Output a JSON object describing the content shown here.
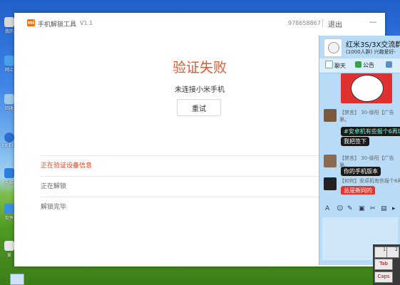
{
  "desktop": {
    "icons": [
      {
        "label": "我的",
        "icon": "computer-icon"
      },
      {
        "label": "网上",
        "icon": "network-icon"
      },
      {
        "label": "回收",
        "icon": "recycle-bin-icon"
      },
      {
        "label": "Int Exp",
        "icon": "internet-explorer-icon"
      },
      {
        "label": "电脑",
        "icon": "security-shield-icon"
      },
      {
        "label": "软件",
        "icon": "software-icon"
      },
      {
        "label": "爱",
        "icon": "app-icon"
      }
    ]
  },
  "unlock_app": {
    "title": "手机解锁工具",
    "version": "V1.1",
    "account_id": "978658867",
    "logout_label": "退出",
    "minimize_label": "—",
    "status_title": "验证失败",
    "status_subtitle": "未连接小米手机",
    "retry_label": "重试",
    "steps": [
      {
        "label": "正在验证设备信息",
        "state": "active"
      },
      {
        "label": "正在解锁",
        "state": "pending"
      },
      {
        "label": "解锁完毕",
        "state": "pending"
      }
    ],
    "accent_color": "#ff6700",
    "error_color": "#e4572e"
  },
  "qq_group": {
    "name": "红米3S/3X交流群",
    "sub": "(1000人群) 兴趣爱好-",
    "tabs": [
      {
        "label": "聊天",
        "icon": "chat-icon"
      },
      {
        "label": "公告",
        "icon": "announcement-icon"
      },
      {
        "label": "",
        "icon": "photo-icon"
      }
    ],
    "messages": [
      {
        "meta": "【禁言】 30-级阳【广告",
        "cont": "第。",
        "bubble": "#安卓机有些报个6再填",
        "bubble2": "我把签下"
      },
      {
        "meta": "【禁言】 30-级阳【广告",
        "cont": "第。",
        "bubble": "你的手机版本"
      },
      {
        "meta": "【如何】安卓机有些报个6再",
        "bubble": "总是新同的"
      }
    ],
    "toolbar_icons": [
      "font-icon",
      "emoji-icon",
      "shake-icon",
      "gift-icon",
      "screenshot-icon",
      "image-icon",
      "more-icon"
    ]
  },
  "on_screen_keyboard": {
    "numbers": [
      "1",
      "2"
    ],
    "keys": [
      "Tab",
      "Caps"
    ]
  }
}
